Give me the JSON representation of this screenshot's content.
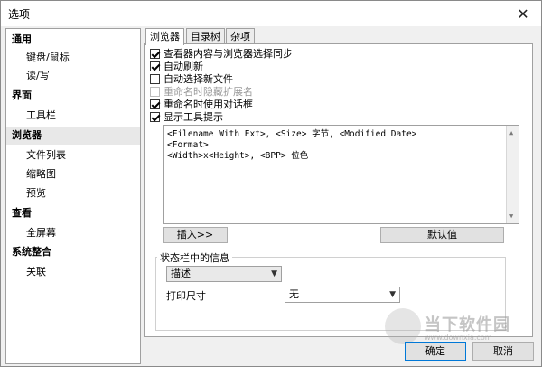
{
  "window": {
    "title": "选项"
  },
  "tree": {
    "items": [
      {
        "label": "通用",
        "kind": "category"
      },
      {
        "label": "键盘/鼠标",
        "kind": "sub"
      },
      {
        "label": "读/写",
        "kind": "sub"
      },
      {
        "label": "界面",
        "kind": "category"
      },
      {
        "label": "工具栏",
        "kind": "sub"
      },
      {
        "label": "浏览器",
        "kind": "category",
        "selected": true
      },
      {
        "label": "文件列表",
        "kind": "sub"
      },
      {
        "label": "缩略图",
        "kind": "sub"
      },
      {
        "label": "预览",
        "kind": "sub"
      },
      {
        "label": "查看",
        "kind": "category"
      },
      {
        "label": "全屏幕",
        "kind": "sub"
      },
      {
        "label": "系统整合",
        "kind": "category"
      },
      {
        "label": "关联",
        "kind": "sub"
      }
    ]
  },
  "tabs": [
    {
      "label": "浏览器",
      "active": true
    },
    {
      "label": "目录树",
      "active": false
    },
    {
      "label": "杂项",
      "active": false
    }
  ],
  "checkboxes": [
    {
      "label": "查看器内容与浏览器选择同步",
      "checked": true,
      "disabled": false
    },
    {
      "label": "自动刷新",
      "checked": true,
      "disabled": false
    },
    {
      "label": "自动选择新文件",
      "checked": false,
      "disabled": false
    },
    {
      "label": "重命名时隐藏扩展名",
      "checked": false,
      "disabled": true
    },
    {
      "label": "重命名时使用对话框",
      "checked": true,
      "disabled": false
    },
    {
      "label": "显示工具提示",
      "checked": true,
      "disabled": false
    }
  ],
  "tooltip_format": {
    "lines": [
      "<Filename With Ext>, <Size> 字节, <Modified Date>",
      "<Format>",
      "<Width>x<Height>, <BPP> 位色"
    ]
  },
  "buttons": {
    "insert": "插入>>",
    "default": "默认值",
    "ok": "确定",
    "cancel": "取消"
  },
  "status_group": {
    "title": "状态栏中的信息",
    "status_select": {
      "value": "描述"
    },
    "print_label": "打印尺寸",
    "print_select": {
      "value": "无"
    }
  },
  "watermark": {
    "text": "当下软件园",
    "url": "www.downxia.com"
  },
  "icons": {
    "close": "close-icon",
    "dropdown": "chevron-down-icon"
  }
}
